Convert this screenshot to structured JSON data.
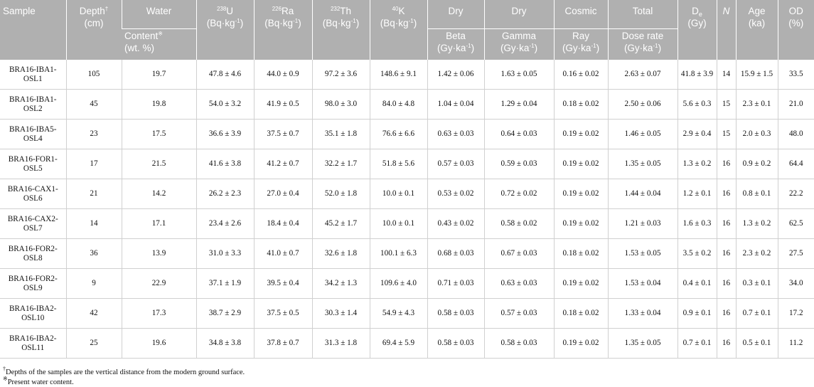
{
  "header": {
    "sample": "Sample",
    "depth": "Depth",
    "depth_mark": "†",
    "depth_unit": "(cm)",
    "water_top": "Water",
    "water_bottom": "Content",
    "water_mark": "※",
    "water_unit": "(wt. %)",
    "u_iso": "238",
    "u_el": "U",
    "u_unit": "(Bq·kg",
    "ra_iso": "226",
    "ra_el": "Ra",
    "ra_unit": "(Bq·kg",
    "th_iso": "232",
    "th_el": "Th",
    "th_unit": "(Bq·kg",
    "k_iso": "40",
    "k_el": "K",
    "k_unit": "(Bq·kg",
    "unit_exp": "-1",
    "unit_close": ")",
    "beta_top": "Dry",
    "beta_bottom": "Beta",
    "beta_unit": "(Gy·ka",
    "gamma_top": "Dry",
    "gamma_bottom": "Gamma",
    "gamma_unit": "(Gy·ka",
    "cosmic_top": "Cosmic",
    "cosmic_bottom": "Ray",
    "cosmic_unit": "(Gy·ka",
    "total_top": "Total",
    "total_bottom": "Dose rate",
    "total_unit": "(Gy·ka",
    "de_base": "D",
    "de_sub": "e",
    "de_unit": "(Gy)",
    "n": "N",
    "age": "Age",
    "age_unit": "(ka)",
    "od": "OD",
    "od_unit": "(%)"
  },
  "rows": [
    {
      "sample": "BRA16-IBA1-OSL1",
      "depth": "105",
      "water": "19.7",
      "u": "47.8 ± 4.6",
      "ra": "44.0 ± 0.9",
      "th": "97.2 ± 3.6",
      "k": "148.6 ± 9.1",
      "beta": "1.42 ± 0.06",
      "gamma": "1.63 ± 0.05",
      "cosmic": "0.16 ± 0.02",
      "total": "2.63 ± 0.07",
      "de": "41.8 ± 3.9",
      "n": "14",
      "age": "15.9 ± 1.5",
      "od": "33.5"
    },
    {
      "sample": "BRA16-IBA1-OSL2",
      "depth": "45",
      "water": "19.8",
      "u": "54.0 ± 3.2",
      "ra": "41.9 ± 0.5",
      "th": "98.0 ± 3.0",
      "k": "84.0 ± 4.8",
      "beta": "1.04 ± 0.04",
      "gamma": "1.29 ± 0.04",
      "cosmic": "0.18 ± 0.02",
      "total": "2.50 ± 0.06",
      "de": "5.6 ± 0.3",
      "n": "15",
      "age": "2.3 ± 0.1",
      "od": "21.0"
    },
    {
      "sample": "BRA16-IBA5-OSL4",
      "depth": "23",
      "water": "17.5",
      "u": "36.6 ± 3.9",
      "ra": "37.5 ± 0.7",
      "th": "35.1 ± 1.8",
      "k": "76.6 ± 6.6",
      "beta": "0.63 ± 0.03",
      "gamma": "0.64 ± 0.03",
      "cosmic": "0.19 ± 0.02",
      "total": "1.46 ± 0.05",
      "de": "2.9 ± 0.4",
      "n": "15",
      "age": "2.0 ± 0.3",
      "od": "48.0"
    },
    {
      "sample": "BRA16-FOR1-OSL5",
      "depth": "17",
      "water": "21.5",
      "u": "41.6 ± 3.8",
      "ra": "41.2 ± 0.7",
      "th": "32.2 ± 1.7",
      "k": "51.8 ± 5.6",
      "beta": "0.57 ± 0.03",
      "gamma": "0.59 ± 0.03",
      "cosmic": "0.19 ± 0.02",
      "total": "1.35 ± 0.05",
      "de": "1.3 ± 0.2",
      "n": "16",
      "age": "0.9 ± 0.2",
      "od": "64.4"
    },
    {
      "sample": "BRA16-CAX1-OSL6",
      "depth": "21",
      "water": "14.2",
      "u": "26.2 ± 2.3",
      "ra": "27.0 ± 0.4",
      "th": "52.0 ± 1.8",
      "k": "10.0 ± 0.1",
      "beta": "0.53 ± 0.02",
      "gamma": "0.72 ± 0.02",
      "cosmic": "0.19 ± 0.02",
      "total": "1.44 ± 0.04",
      "de": "1.2 ± 0.1",
      "n": "16",
      "age": "0.8 ± 0.1",
      "od": "22.2"
    },
    {
      "sample": "BRA16-CAX2-OSL7",
      "depth": "14",
      "water": "17.1",
      "u": "23.4 ± 2.6",
      "ra": "18.4 ± 0.4",
      "th": "45.2 ± 1.7",
      "k": "10.0 ± 0.1",
      "beta": "0.43 ± 0.02",
      "gamma": "0.58 ± 0.02",
      "cosmic": "0.19 ± 0.02",
      "total": "1.21 ± 0.03",
      "de": "1.6 ± 0.3",
      "n": "16",
      "age": "1.3 ± 0.2",
      "od": "62.5"
    },
    {
      "sample": "BRA16-FOR2-OSL8",
      "depth": "36",
      "water": "13.9",
      "u": "31.0 ± 3.3",
      "ra": "41.0 ± 0.7",
      "th": "32.6 ± 1.8",
      "k": "100.1 ± 6.3",
      "beta": "0.68 ± 0.03",
      "gamma": "0.67 ± 0.03",
      "cosmic": "0.18 ± 0.02",
      "total": "1.53 ± 0.05",
      "de": "3.5 ± 0.2",
      "n": "16",
      "age": "2.3 ± 0.2",
      "od": "27.5"
    },
    {
      "sample": "BRA16-FOR2-OSL9",
      "depth": "9",
      "water": "22.9",
      "u": "37.1 ± 1.9",
      "ra": "39.5 ± 0.4",
      "th": "34.2 ± 1.3",
      "k": "109.6 ± 4.0",
      "beta": "0.71 ± 0.03",
      "gamma": "0.63 ± 0.03",
      "cosmic": "0.19 ± 0.02",
      "total": "1.53 ± 0.04",
      "de": "0.4 ± 0.1",
      "n": "16",
      "age": "0.3 ± 0.1",
      "od": "34.0"
    },
    {
      "sample": "BRA16-IBA2-OSL10",
      "depth": "42",
      "water": "17.3",
      "u": "38.7 ± 2.9",
      "ra": "37.5 ± 0.5",
      "th": "30.3 ± 1.4",
      "k": "54.9 ± 4.3",
      "beta": "0.58 ± 0.03",
      "gamma": "0.57 ± 0.03",
      "cosmic": "0.18 ± 0.02",
      "total": "1.33 ± 0.04",
      "de": "0.9 ± 0.1",
      "n": "16",
      "age": "0.7 ± 0.1",
      "od": "17.2"
    },
    {
      "sample": "BRA16-IBA2-OSL11",
      "depth": "25",
      "water": "19.6",
      "u": "34.8 ± 3.8",
      "ra": "37.8 ± 0.7",
      "th": "31.3 ± 1.8",
      "k": "69.4 ± 5.9",
      "beta": "0.58 ± 0.03",
      "gamma": "0.58 ± 0.03",
      "cosmic": "0.19 ± 0.02",
      "total": "1.35 ± 0.05",
      "de": "0.7 ± 0.1",
      "n": "16",
      "age": "0.5 ± 0.1",
      "od": "11.2"
    }
  ],
  "footnotes": {
    "depth_mark": "†",
    "depth_text": "Depths of the samples are the vertical distance from the modern ground surface.",
    "water_mark": "※",
    "water_text": "Present water content."
  }
}
